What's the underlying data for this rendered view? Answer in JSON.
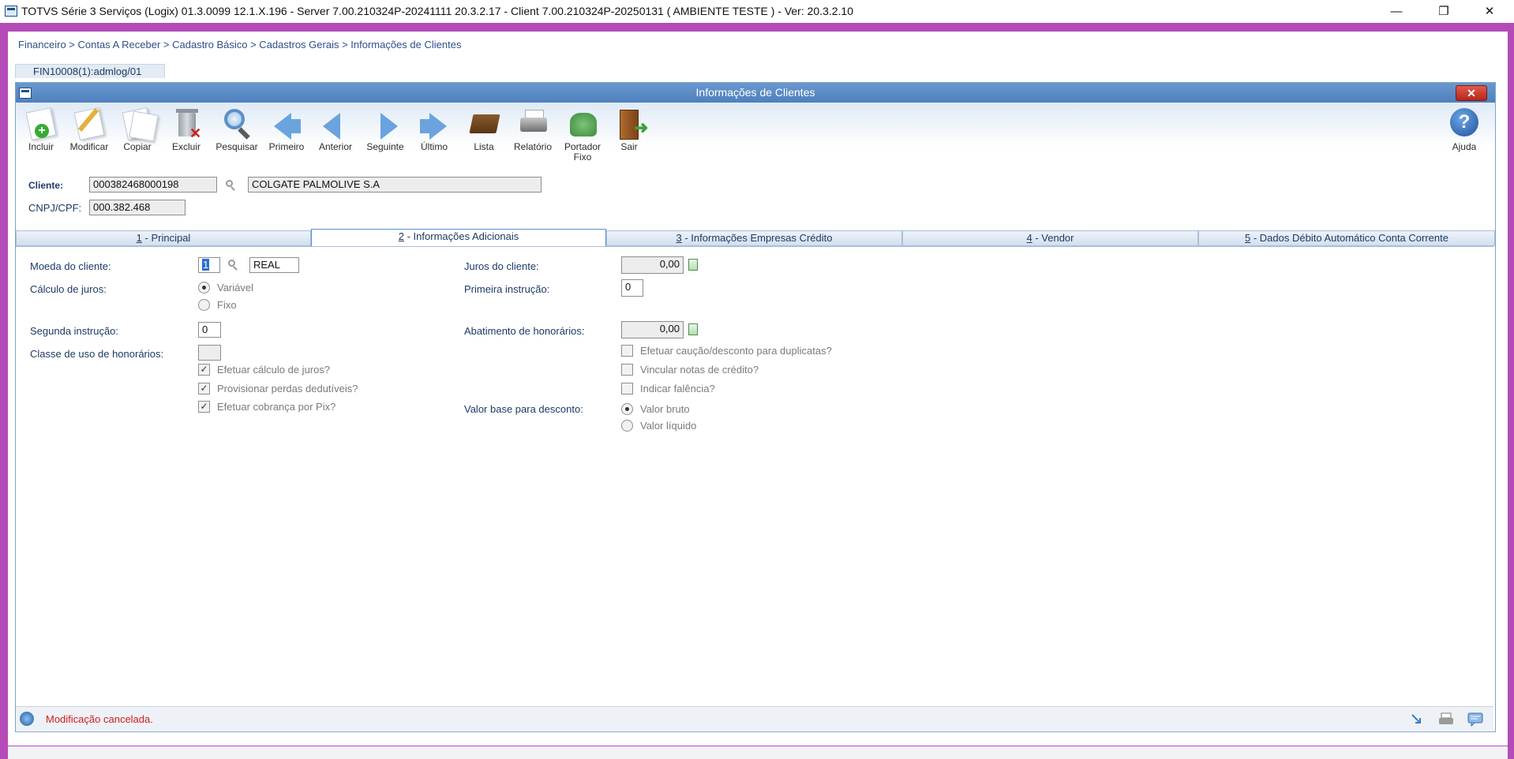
{
  "window_title": "TOTVS Série 3 Serviços (Logix) 01.3.0099   12.1.X.196 - Server 7.00.210324P-20241111 20.3.2.17 - Client 7.00.210324P-20250131    ( AMBIENTE TESTE )  - Ver: 20.3.2.10",
  "window_controls": {
    "minimize": "—",
    "restore": "❐",
    "close": "✕"
  },
  "breadcrumb": "Financeiro > Contas A Receber > Cadastro Básico > Cadastros Gerais > Informações de Clientes",
  "program_tab": "FIN10008(1):admlog/01",
  "dialog": {
    "title": "Informações de Clientes",
    "close": "✕"
  },
  "toolbar": {
    "incluir": "Incluir",
    "modificar": "Modificar",
    "copiar": "Copiar",
    "excluir": "Excluir",
    "pesquisar": "Pesquisar",
    "primeiro": "Primeiro",
    "anterior": "Anterior",
    "seguinte": "Seguinte",
    "ultimo": "Último",
    "lista": "Lista",
    "relatorio": "Relatório",
    "portador_1": "Portador",
    "portador_2": "Fixo",
    "sair": "Sair",
    "ajuda": "Ajuda"
  },
  "header": {
    "cliente_label": "Cliente:",
    "cliente_code": "000382468000198",
    "cliente_name": "COLGATE PALMOLIVE S.A",
    "cnpj_label": "CNPJ/CPF:",
    "cnpj_value": "000.382.468"
  },
  "tabs": [
    {
      "num": "1",
      "label": " - Principal"
    },
    {
      "num": "2",
      "label": " - Informações Adicionais"
    },
    {
      "num": "3",
      "label": " - Informações Empresas Crédito"
    },
    {
      "num": "4",
      "label": " - Vendor"
    },
    {
      "num": "5",
      "label": " - Dados Débito Automático Conta Corrente"
    }
  ],
  "form": {
    "moeda_label": "Moeda do cliente:",
    "moeda_code": "1",
    "moeda_name": "REAL",
    "calculo_label": "Cálculo de  juros:",
    "calculo_options": [
      "Variável",
      "Fixo"
    ],
    "segunda_label": "Segunda instrução:",
    "segunda_value": "0",
    "classe_label": "Classe de uso de honorários:",
    "classe_value": "",
    "check_juros": "Efetuar cálculo de juros?",
    "check_perdas": "Provisionar perdas dedutíveis?",
    "check_pix": "Efetuar cobrança por Pix?",
    "juros_label": "Juros do cliente:",
    "juros_value": "0,00",
    "primeira_label": "Primeira instrução:",
    "primeira_value": "0",
    "abatimento_label": "Abatimento de honorários:",
    "abatimento_value": "0,00",
    "check_caucao": "Efetuar caução/desconto para duplicatas?",
    "check_vincular": "Vincular notas de crédito?",
    "check_falencia": "Indicar falência?",
    "valor_base_label": "Valor base para desconto:",
    "valor_base_options": [
      "Valor bruto",
      "Valor líquido"
    ]
  },
  "status": {
    "message": "Modificação cancelada."
  }
}
